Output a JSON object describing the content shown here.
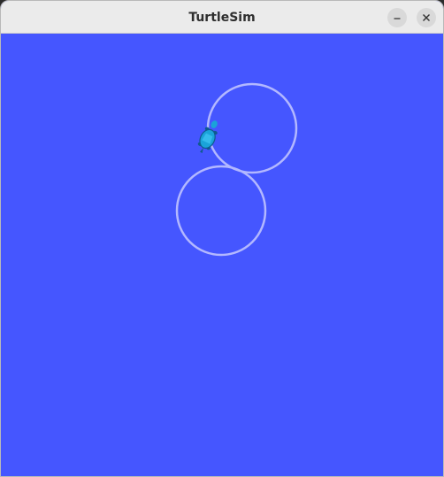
{
  "window": {
    "title": "TurtleSim",
    "minimize_icon": "minimize-icon",
    "close_icon": "close-icon"
  },
  "canvas": {
    "background_color": "#4556ff",
    "pen_color": "#b3b8ff",
    "turtle_icon": "turtle-icon",
    "turtle_color": "#1aa3d9"
  }
}
